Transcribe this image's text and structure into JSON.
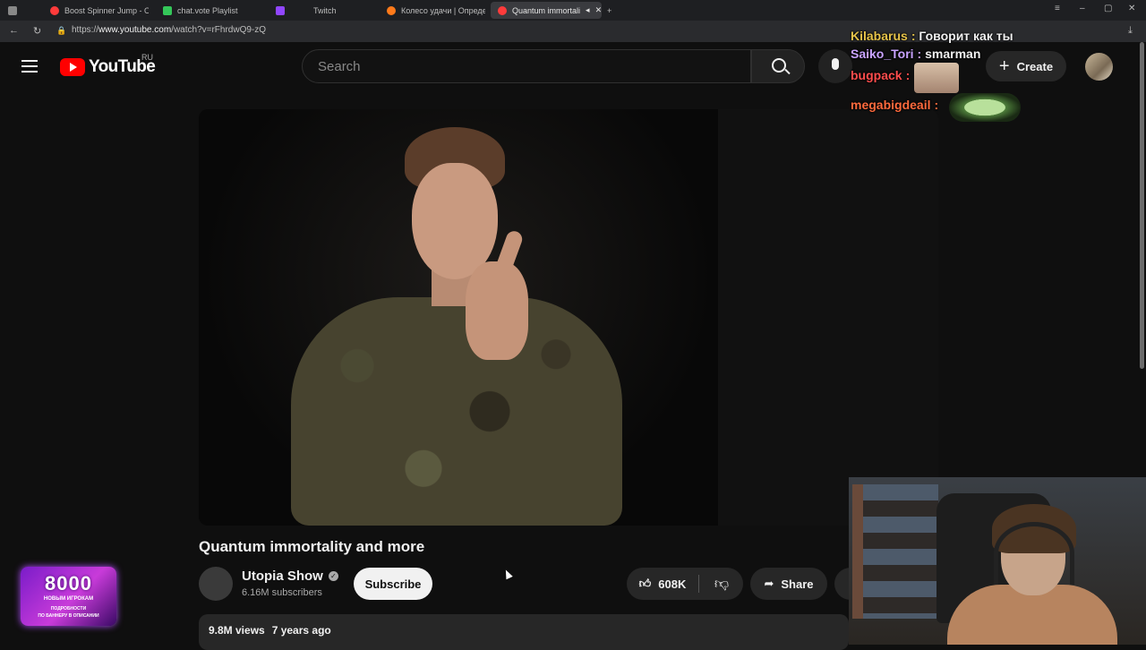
{
  "browser": {
    "tabs": [
      {
        "title": "Boost Spinner Jump - One",
        "color": "#ff3b3b"
      },
      {
        "title": "chat.vote Playlist",
        "color": "#34c759"
      },
      {
        "title": "Twitch",
        "color": "#9146ff"
      },
      {
        "title": "Колесо удачи | Определи",
        "color": "#ff7a1a"
      },
      {
        "title": "Quantum immortali",
        "color": "#ff3b3b"
      }
    ],
    "url_scheme": "https://",
    "url_host": "www.youtube.com",
    "url_path": "/watch?v=rFhrdwQ9-zQ"
  },
  "header": {
    "logo_text": "YouTube",
    "region": "RU",
    "search_placeholder": "Search",
    "create_label": "Create"
  },
  "video": {
    "title": "Quantum immortality and more",
    "channel_name": "Utopia Show",
    "subscribers": "6.16M subscribers",
    "subscribe_label": "Subscribe",
    "likes": "608K",
    "share_label": "Share",
    "views": "9.8M views",
    "age": "7 years ago"
  },
  "chat": [
    {
      "user": "Kilabarus",
      "color": "#e6c34a",
      "message": "Говорит как ты"
    },
    {
      "user": "Saiko_Tori",
      "color": "#c9a3ff",
      "message": "smarman"
    },
    {
      "user": "bugpack",
      "color": "#ff4d4d",
      "message": ""
    },
    {
      "user": "megabigdeail",
      "color": "#ff6a3d",
      "message": ""
    }
  ],
  "promo": {
    "big": "8000",
    "line1": "НОВЫМ ИГРОКАМ",
    "line2": "ПОДРОБНОСТИ",
    "line3": "ПО БАННЕРУ В ОПИСАНИИ"
  }
}
